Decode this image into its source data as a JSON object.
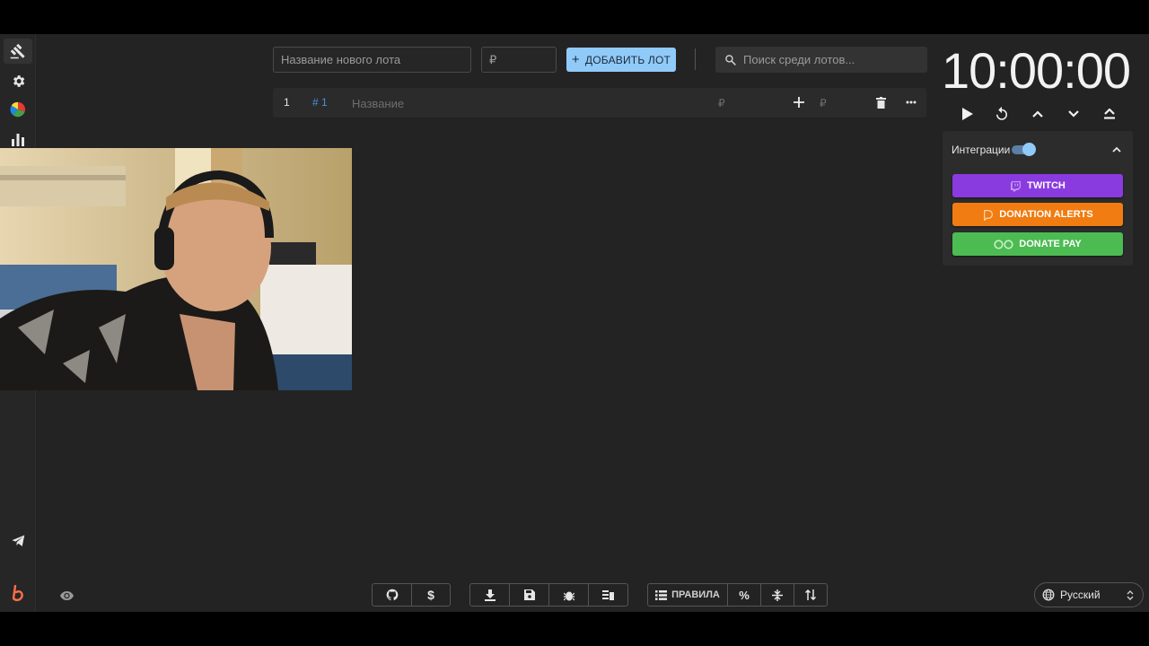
{
  "toolbar": {
    "new_lot_placeholder": "Название нового лота",
    "price_placeholder": "₽",
    "add_lot_label": "ДОБАВИТЬ ЛОТ",
    "search_placeholder": "Поиск среди лотов..."
  },
  "lot": {
    "index": "1",
    "tag": "# 1",
    "name_placeholder": "Название",
    "currency": "₽",
    "currency2": "₽"
  },
  "timer": {
    "display": "10:00:00"
  },
  "integrations": {
    "label": "Интеграции",
    "enabled": true,
    "buttons": [
      {
        "label": "TWITCH",
        "color": "#8a3be0"
      },
      {
        "label": "DONATION ALERTS",
        "color": "#f07c12"
      },
      {
        "label": "DONATE PAY",
        "color": "#4cbc52"
      }
    ]
  },
  "bottom": {
    "rules_label": "ПРАВИЛА"
  },
  "language": {
    "selected": "Русский"
  },
  "colors": {
    "accent": "#90caf9",
    "background": "#232323"
  }
}
